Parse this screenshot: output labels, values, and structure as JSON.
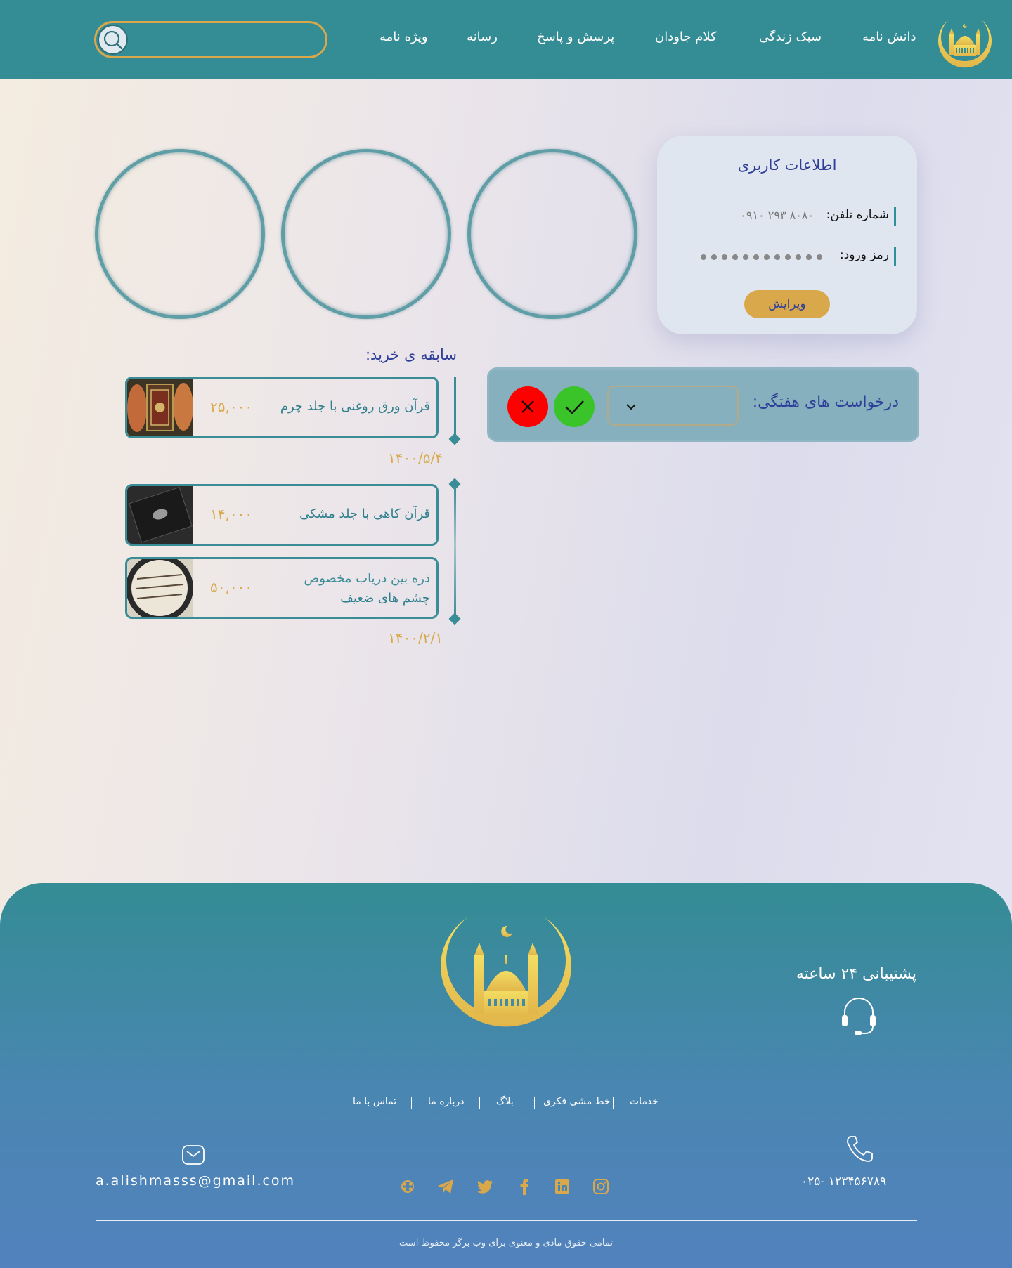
{
  "header": {
    "nav": [
      {
        "label": "دانش نامه"
      },
      {
        "label": "سبک زندگی"
      },
      {
        "label": "کلام جاودان"
      },
      {
        "label": "پرسش و پاسخ"
      },
      {
        "label": "رسانه"
      },
      {
        "label": "ویژه نامه"
      }
    ],
    "search": {
      "placeholder": "",
      "value": ""
    }
  },
  "profile": {
    "title": "اطلاعات کاربری",
    "phone_label": "شماره تلفن:",
    "phone_value": "۰۹۱۰ ۲۹۳ ۸۰۸۰",
    "password_label": "رمز ورود:",
    "password_dots": 12,
    "edit_label": "ویرایش"
  },
  "weekly": {
    "title": "درخواست های هفتگی:",
    "selected": ""
  },
  "history": {
    "title": "سابقه ی خرید:",
    "items": [
      {
        "name": "قرآن ورق روغنی با جلد چرم",
        "price": "۲۵,۰۰۰"
      },
      {
        "name": "قرآن کاهی با جلد مشکی",
        "price": "۱۴,۰۰۰"
      },
      {
        "name_line1": "ذره بین دریاب مخصوص",
        "name_line2": "چشم های ضعیف",
        "price": "۵۰,۰۰۰"
      }
    ],
    "dates": [
      "۱۴۰۰/۵/۴",
      "۱۴۰۰/۲/۱"
    ]
  },
  "footer": {
    "support": "پشتیبانی ۲۴ ساعته",
    "links": [
      "خدمات",
      "خط مشی فکری",
      "بلاگ",
      "درباره ما",
      "تماس با ما"
    ],
    "phone": "۰۲۵- ۱۲۳۴۵۶۷۸۹",
    "email": "a.alishmasss@gmail.com",
    "social_icons": [
      "instagram-icon",
      "linkedin-icon",
      "facebook-icon",
      "twitter-icon",
      "telegram-icon",
      "aparat-icon"
    ],
    "copyright": "تمامی حقوق مادی و معنوی برای وب برگر محفوظ است"
  },
  "colors": {
    "teal": "#348c94",
    "gold": "#d9a84a",
    "navy_text": "#2e3f9a",
    "confirm": "#3bc42a",
    "reject": "#ff0000"
  }
}
